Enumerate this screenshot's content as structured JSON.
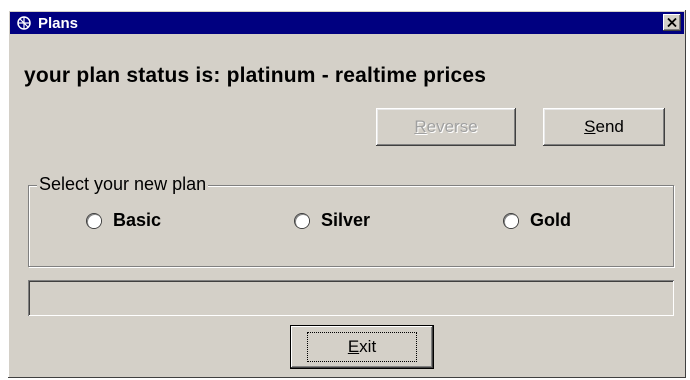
{
  "window": {
    "title": "Plans",
    "icons": {
      "app": "app-icon",
      "close": "close-icon"
    },
    "colors": {
      "titlebar": "#000080",
      "face": "#d4d0c8"
    }
  },
  "status": {
    "text": "your plan status is: platinum - realtime prices"
  },
  "toolbar": {
    "reverse": {
      "accel": "R",
      "rest": "everse",
      "disabled": true
    },
    "send": {
      "accel": "S",
      "rest": "end"
    }
  },
  "plan_group": {
    "legend": "Select your new plan",
    "options": [
      {
        "label": "Basic",
        "selected": false
      },
      {
        "label": "Silver",
        "selected": false
      },
      {
        "label": "Gold",
        "selected": false
      }
    ]
  },
  "status_field": {
    "value": ""
  },
  "footer": {
    "exit": {
      "accel": "E",
      "rest": "xit"
    }
  }
}
